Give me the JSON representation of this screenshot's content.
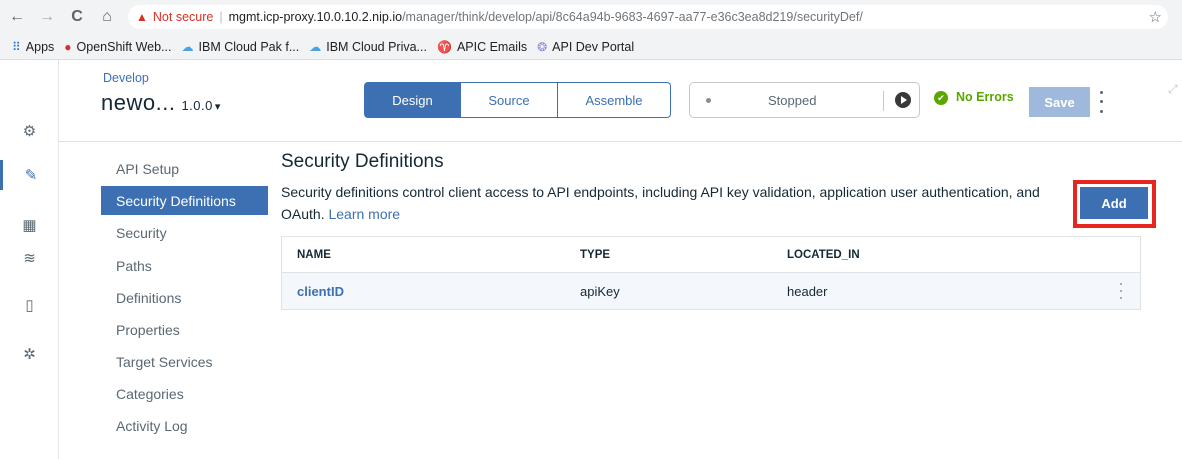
{
  "browser": {
    "back": "←",
    "forward": "→",
    "reload": "C",
    "home": "⌂",
    "security_icon": "warning-icon",
    "not_secure": "Not secure",
    "url_host": "mgmt.icp-proxy.10.0.10.2.nip.io",
    "url_path": "/manager/think/develop/api/8c64a94b-9683-4697-aa77-e36c3ea8d219/securityDef/",
    "bookmarks": [
      {
        "label": "Apps",
        "icon": "apps-grid-icon"
      },
      {
        "label": "OpenShift Web...",
        "icon": "openshift-icon"
      },
      {
        "label": "IBM Cloud Pak f...",
        "icon": "cloud-icon"
      },
      {
        "label": "IBM Cloud Priva...",
        "icon": "cloud-icon"
      },
      {
        "label": "APIC Emails",
        "icon": "apic-icon"
      },
      {
        "label": "API Dev Portal",
        "icon": "portal-icon"
      }
    ]
  },
  "header": {
    "breadcrumb": "Develop",
    "api_name": "newo...",
    "api_version": "1.0.0",
    "tabs": [
      "Design",
      "Source",
      "Assemble"
    ],
    "active_tab": "Design",
    "run_status": "Stopped",
    "validation": "No Errors",
    "save_label": "Save"
  },
  "rail": [
    "gear-outline-icon",
    "edit-icon",
    "dashboard-icon",
    "layers-icon",
    "badge-icon",
    "settings-icon"
  ],
  "nav": {
    "items": [
      "API Setup",
      "Security Definitions",
      "Security",
      "Paths",
      "Definitions",
      "Properties",
      "Target Services",
      "Categories",
      "Activity Log"
    ],
    "active": "Security Definitions"
  },
  "main": {
    "title": "Security Definitions",
    "description": "Security definitions control client access to API endpoints, including API key validation, application user authentication, and OAuth.",
    "learn_more": "Learn more",
    "add_label": "Add",
    "table": {
      "columns": [
        "NAME",
        "TYPE",
        "LOCATED_IN"
      ],
      "rows": [
        {
          "name": "clientID",
          "type": "apiKey",
          "located_in": "header"
        }
      ]
    }
  },
  "colors": {
    "accent": "#3d70b2",
    "highlight": "#e52720",
    "ok": "#5aa700"
  }
}
